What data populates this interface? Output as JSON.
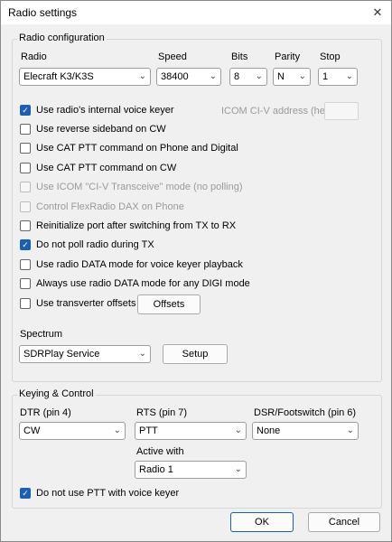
{
  "window": {
    "title": "Radio settings",
    "close_glyph": "✕"
  },
  "radio_config": {
    "group_label": "Radio configuration",
    "radio": {
      "label": "Radio",
      "value": "Elecraft K3/K3S"
    },
    "speed": {
      "label": "Speed",
      "value": "38400"
    },
    "bits": {
      "label": "Bits",
      "value": "8"
    },
    "parity": {
      "label": "Parity",
      "value": "N"
    },
    "stop": {
      "label": "Stop",
      "value": "1"
    },
    "icom_address_label": "ICOM CI-V address (hex)",
    "options": [
      {
        "label": "Use radio's internal voice keyer",
        "checked": true,
        "enabled": true
      },
      {
        "label": "Use reverse sideband on CW",
        "checked": false,
        "enabled": true
      },
      {
        "label": "Use CAT PTT command on Phone and Digital",
        "checked": false,
        "enabled": true
      },
      {
        "label": "Use CAT PTT command on CW",
        "checked": false,
        "enabled": true
      },
      {
        "label": "Use ICOM \"CI-V Transceive\" mode (no polling)",
        "checked": false,
        "enabled": false
      },
      {
        "label": "Control FlexRadio DAX on Phone",
        "checked": false,
        "enabled": false
      },
      {
        "label": "Reinitialize port after switching from TX to RX",
        "checked": false,
        "enabled": true
      },
      {
        "label": "Do not poll radio during TX",
        "checked": true,
        "enabled": true
      },
      {
        "label": "Use radio DATA mode for voice keyer playback",
        "checked": false,
        "enabled": true
      },
      {
        "label": "Always use radio DATA mode for any DIGI mode",
        "checked": false,
        "enabled": true
      },
      {
        "label": "Use transverter offsets",
        "checked": false,
        "enabled": true
      }
    ],
    "offsets_button": "Offsets",
    "spectrum": {
      "label": "Spectrum",
      "value": "SDRPlay Service",
      "setup_button": "Setup"
    }
  },
  "keying": {
    "group_label": "Keying & Control",
    "dtr": {
      "label": "DTR (pin 4)",
      "value": "CW"
    },
    "rts": {
      "label": "RTS (pin 7)",
      "value": "PTT"
    },
    "dsr": {
      "label": "DSR/Footswitch (pin 6)",
      "value": "None"
    },
    "active_with": {
      "label": "Active with",
      "value": "Radio 1"
    },
    "no_ptt_voice": {
      "label": "Do not use PTT with voice keyer",
      "checked": true
    }
  },
  "footer": {
    "ok_label": "OK",
    "cancel_label": "Cancel"
  }
}
